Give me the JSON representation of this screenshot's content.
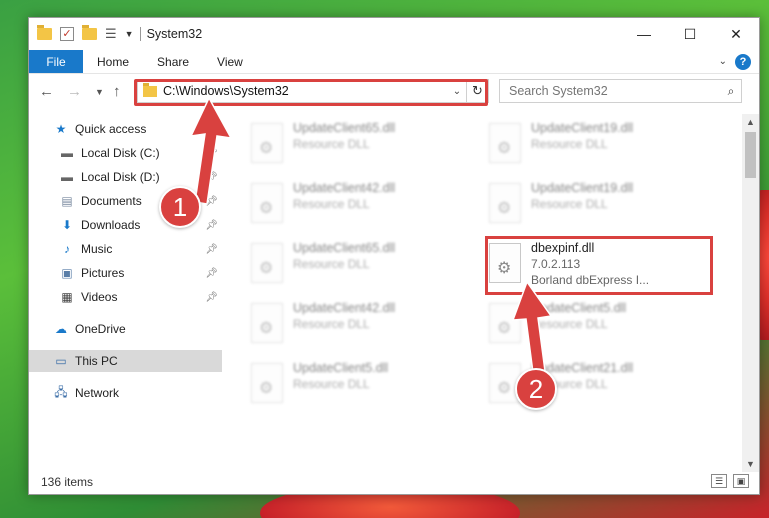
{
  "window": {
    "title": "System32"
  },
  "ribbon": {
    "file": "File",
    "tabs": [
      "Home",
      "Share",
      "View"
    ]
  },
  "address": {
    "path": "C:\\Windows\\System32"
  },
  "search": {
    "placeholder": "Search System32"
  },
  "sidebar": {
    "items": [
      {
        "label": "Quick access",
        "icon": "star-icon"
      },
      {
        "label": "Local Disk (C:)",
        "icon": "drive-icon",
        "pinned": true
      },
      {
        "label": "Local Disk (D:)",
        "icon": "drive-icon",
        "pinned": true
      },
      {
        "label": "Documents",
        "icon": "documents-icon",
        "pinned": true
      },
      {
        "label": "Downloads",
        "icon": "download-icon",
        "pinned": true
      },
      {
        "label": "Music",
        "icon": "music-icon",
        "pinned": true
      },
      {
        "label": "Pictures",
        "icon": "pictures-icon",
        "pinned": true
      },
      {
        "label": "Videos",
        "icon": "videos-icon",
        "pinned": true
      },
      {
        "label": "OneDrive",
        "icon": "cloud-icon"
      },
      {
        "label": "This PC",
        "icon": "computer-icon",
        "selected": true
      },
      {
        "label": "Network",
        "icon": "network-icon"
      }
    ]
  },
  "files": [
    {
      "name": "UpdateClient65.dll",
      "type": "Resource DLL"
    },
    {
      "name": "UpdateClient19.dll",
      "type": "Resource DLL"
    },
    {
      "name": "UpdateClient42.dll",
      "type": "Resource DLL"
    },
    {
      "name": "UpdateClient19.dll",
      "type": "Resource DLL"
    },
    {
      "name": "UpdateClient65.dll",
      "type": "Resource DLL"
    },
    {
      "name": "dbexpinf.dll",
      "version": "7.0.2.113",
      "description": "Borland dbExpress I..."
    },
    {
      "name": "UpdateClient42.dll",
      "type": "Resource DLL"
    },
    {
      "name": "UpdateClient5.dll",
      "type": "Resource DLL"
    },
    {
      "name": "UpdateClient5.dll",
      "type": "Resource DLL"
    },
    {
      "name": "UpdateClient21.dll",
      "type": "Resource DLL"
    }
  ],
  "status": {
    "count": "136 items"
  },
  "annotations": {
    "step1": "1",
    "step2": "2"
  },
  "colors": {
    "accent": "#1979ca",
    "highlight": "#d9413f"
  }
}
